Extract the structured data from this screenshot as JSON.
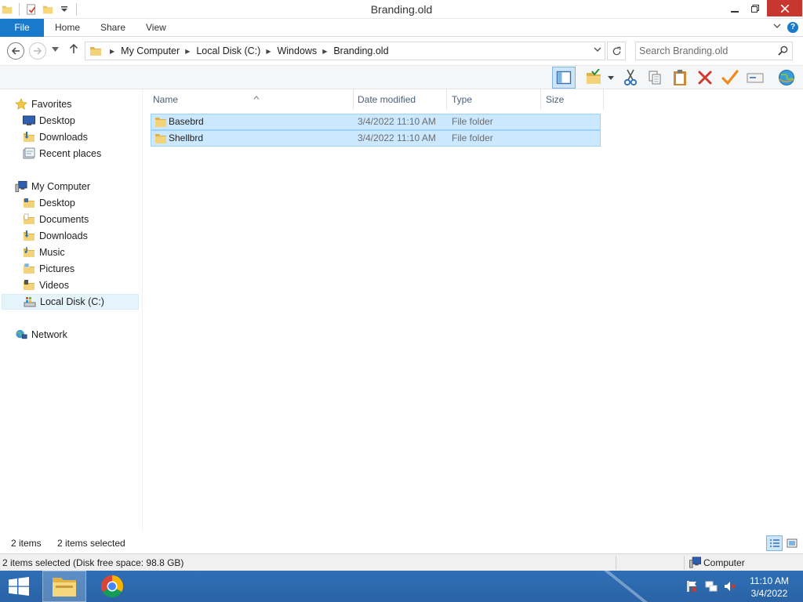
{
  "window": {
    "title": "Branding.old",
    "minimize_glyph": "—",
    "maximize_glyph": "❐",
    "close_glyph": "✕"
  },
  "ribbon": {
    "file_tab": "File",
    "tabs": [
      "Home",
      "Share",
      "View"
    ]
  },
  "address": {
    "crumbs": [
      "My Computer",
      "Local Disk (C:)",
      "Windows",
      "Branding.old"
    ]
  },
  "search": {
    "placeholder": "Search Branding.old"
  },
  "toolbar": {
    "icons": [
      "preview-pane-icon",
      "properties-folder-icon",
      "cut-icon",
      "copy-icon",
      "paste-icon",
      "delete-icon",
      "check-icon",
      "rename-icon",
      "globe-icon"
    ]
  },
  "navpane": {
    "favorites": {
      "label": "Favorites",
      "items": [
        "Desktop",
        "Downloads",
        "Recent places"
      ]
    },
    "computer": {
      "label": "My Computer",
      "items": [
        "Desktop",
        "Documents",
        "Downloads",
        "Music",
        "Pictures",
        "Videos",
        "Local Disk (C:)"
      ]
    },
    "network": {
      "label": "Network"
    }
  },
  "columns": {
    "name": "Name",
    "date": "Date modified",
    "type": "Type",
    "size": "Size"
  },
  "files": [
    {
      "name": "Basebrd",
      "date": "3/4/2022 11:10 AM",
      "type": "File folder",
      "size": ""
    },
    {
      "name": "Shellbrd",
      "date": "3/4/2022 11:10 AM",
      "type": "File folder",
      "size": ""
    }
  ],
  "status": {
    "item_count": "2 items",
    "selected_count": "2 items selected"
  },
  "infobar": {
    "details": "2 items selected (Disk free space: 98.8 GB)",
    "location": "Computer"
  },
  "taskbar": {
    "time": "11:10 AM",
    "date": "3/4/2022"
  },
  "colors": {
    "accent": "#1979ca",
    "selection": "#cce8ff",
    "selection_border": "#99d1ff",
    "taskbar": "#2a63a6"
  }
}
